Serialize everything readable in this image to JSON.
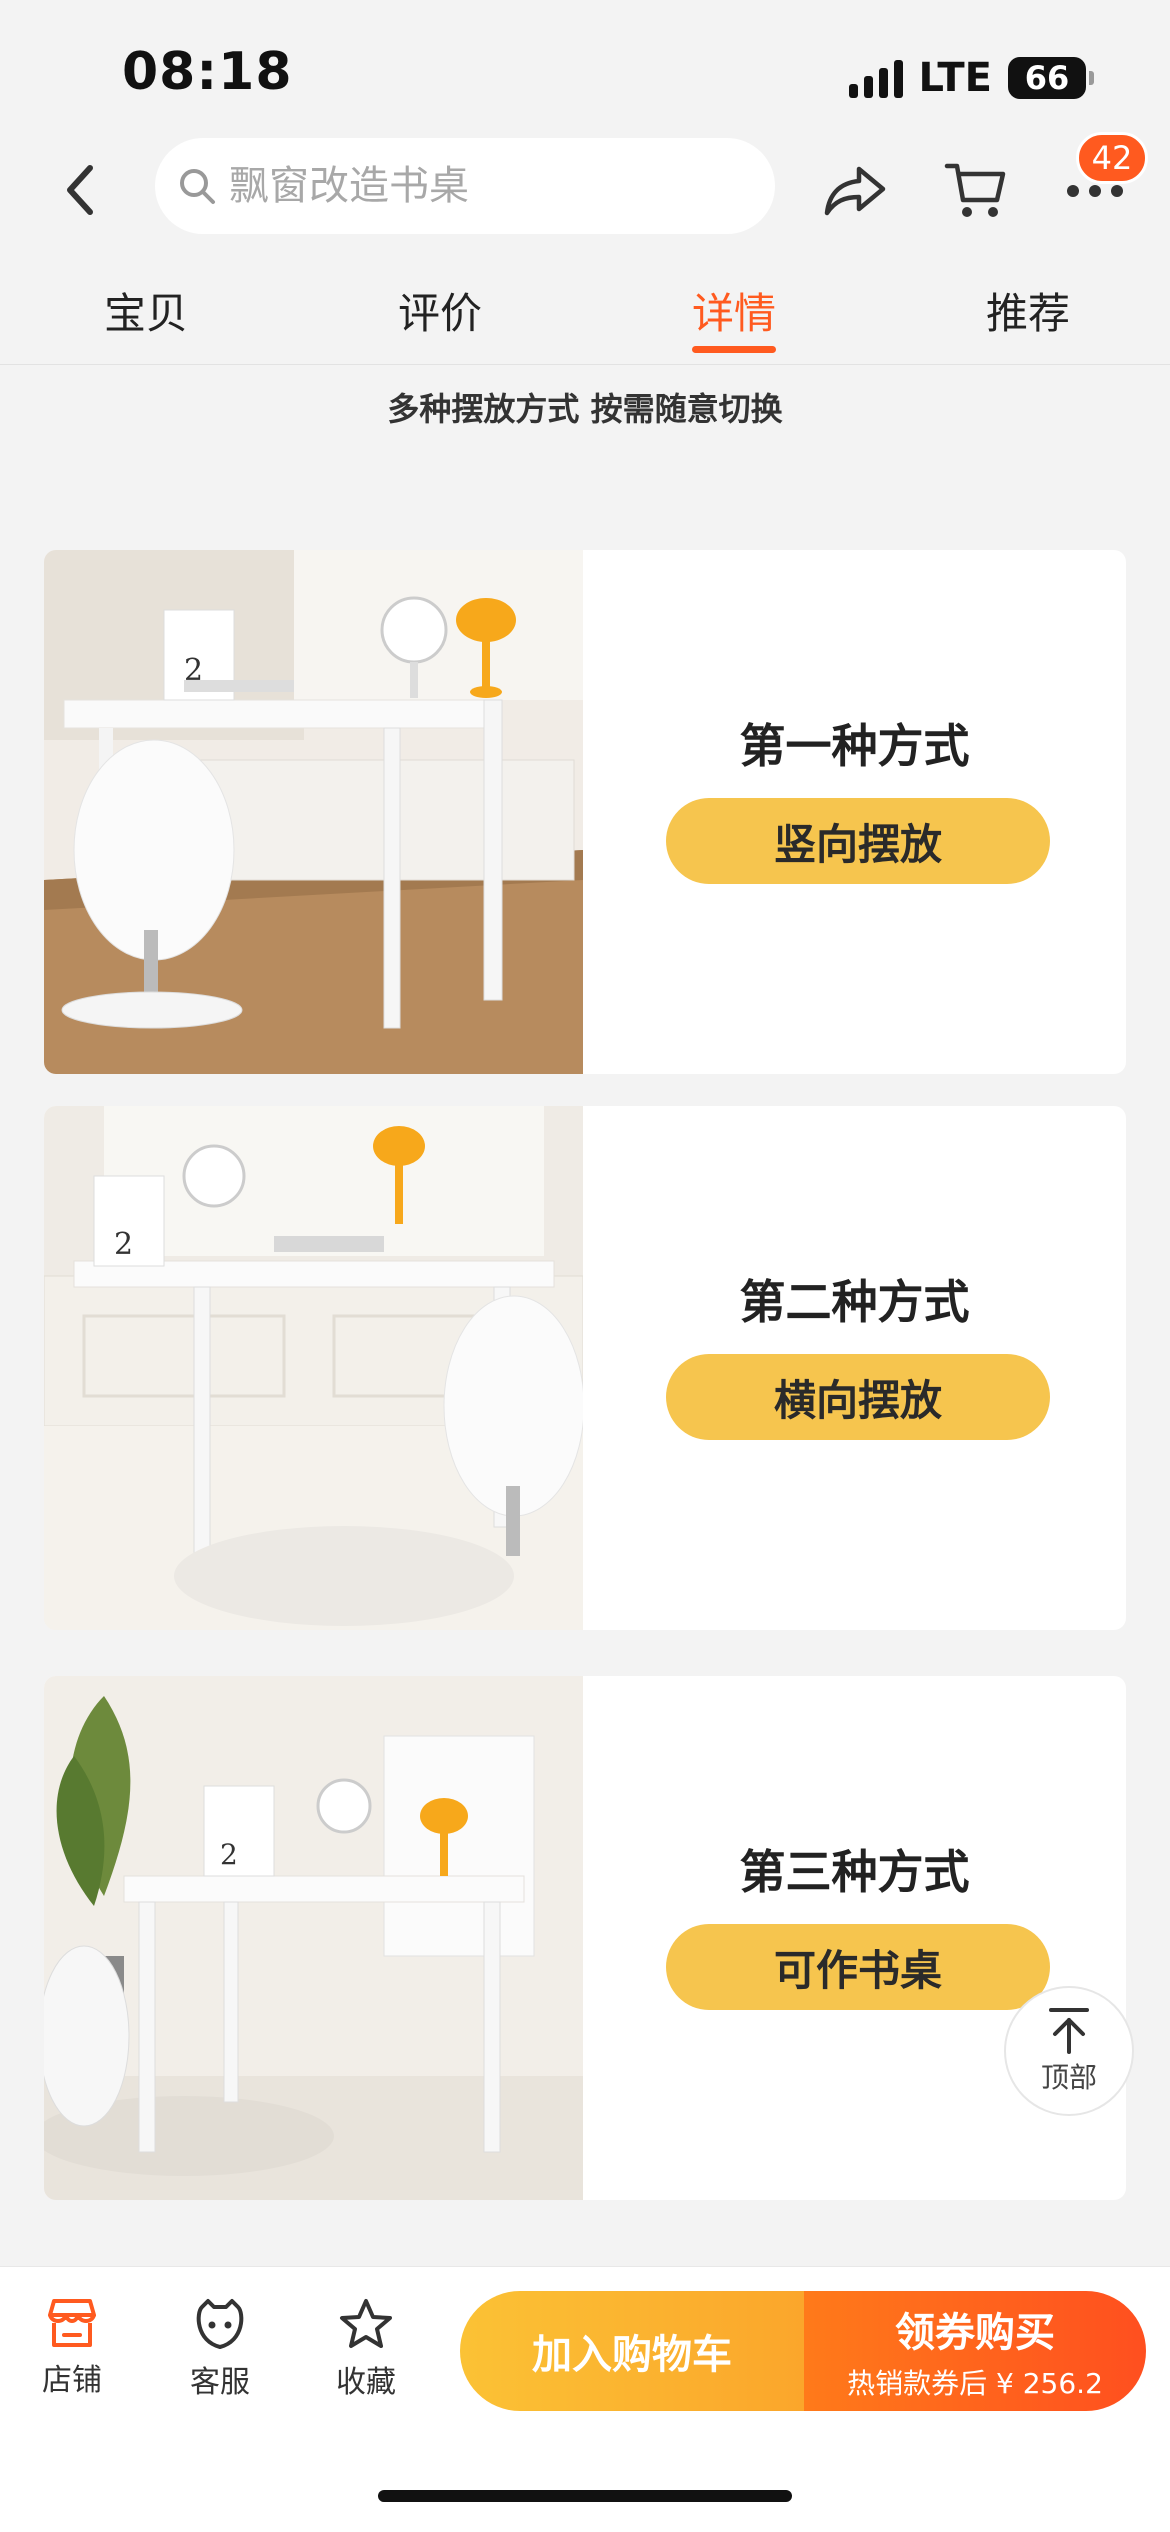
{
  "status": {
    "time": "08:18",
    "network": "LTE",
    "battery": "66"
  },
  "header": {
    "search_placeholder": "飘窗改造书桌",
    "cart_badge": "42",
    "icons": [
      "back-arrow-icon",
      "search-icon",
      "share-icon",
      "cart-icon",
      "more-dots-icon"
    ]
  },
  "tabs": [
    {
      "label": "宝贝",
      "active": false
    },
    {
      "label": "评价",
      "active": false
    },
    {
      "label": "详情",
      "active": true
    },
    {
      "label": "推荐",
      "active": false
    }
  ],
  "detail": {
    "heading": "多种摆放方式 按需随意切换",
    "options": [
      {
        "title": "第一种方式",
        "tag": "竖向摆放"
      },
      {
        "title": "第二种方式",
        "tag": "横向摆放"
      },
      {
        "title": "第三种方式",
        "tag": "可作书桌"
      }
    ]
  },
  "back_to_top": {
    "label": "顶部"
  },
  "bottom_bar": {
    "store": "店铺",
    "service": "客服",
    "favorite": "收藏",
    "add_to_cart": "加入购物车",
    "buy": "领券购买",
    "buy_sub": "热销款券后 ¥ 256.2"
  },
  "colors": {
    "accent": "#ff5a1f",
    "pill": "#f6c54e",
    "cart_button": "#fbb330",
    "buy_button": "#ff6a1f"
  }
}
